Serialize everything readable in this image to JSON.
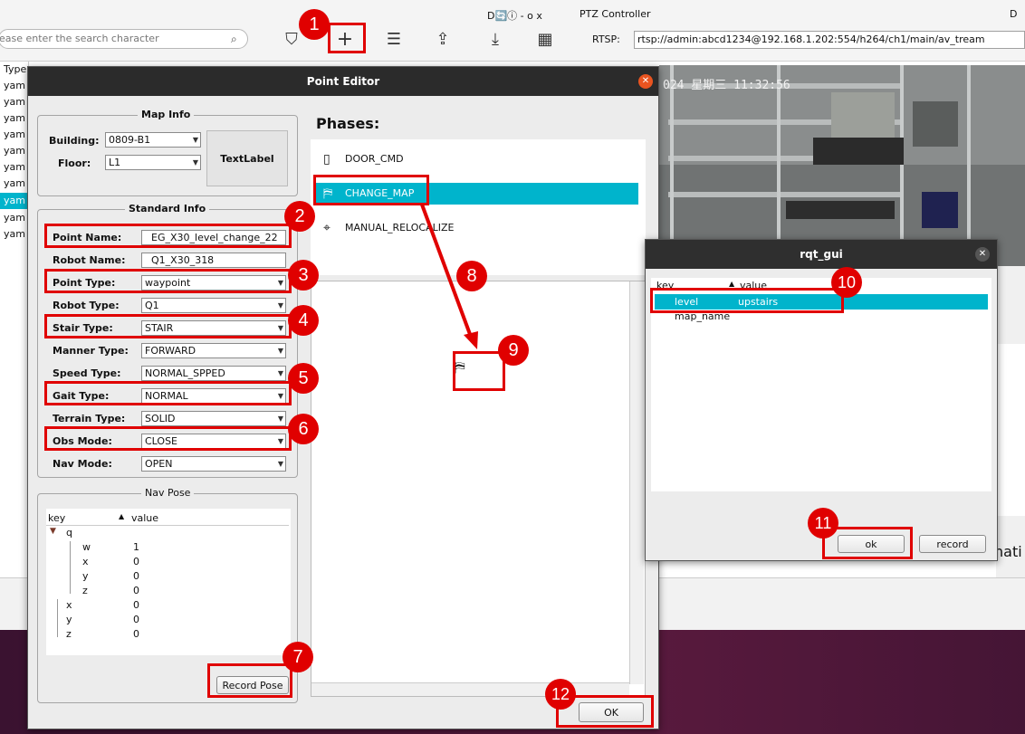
{
  "toolbar": {
    "search_placeholder": "ease enter the search character",
    "window_controls_1": "D🔄ⓘ  - o x",
    "ptz_title": "PTZ Controller",
    "window_controls_2": "D",
    "rtsp_label": "RTSP:",
    "rtsp_value": "rtsp://admin:abcd1234@192.168.1.202:554/h264/ch1/main/av_tream"
  },
  "background": {
    "list_header": "Type",
    "list_items": [
      "yam",
      "yam",
      "yam",
      "yam",
      "yam",
      "yam",
      "yam",
      "yam",
      "yam",
      "yam"
    ],
    "camera_timestamp": "024 星期三 11:32:56",
    "side_text": "nati"
  },
  "point_editor": {
    "title": "Point Editor",
    "map_info": {
      "title": "Map Info",
      "building_label": "Building:",
      "building_value": "0809-B1",
      "floor_label": "Floor:",
      "floor_value": "L1",
      "text_label": "TextLabel"
    },
    "standard_info": {
      "title": "Standard Info",
      "fields": [
        {
          "label": "Point Name:",
          "value": "EG_X30_level_change_22"
        },
        {
          "label": "Robot Name:",
          "value": "Q1_X30_318"
        },
        {
          "label": "Point Type:",
          "value": "waypoint"
        },
        {
          "label": "Robot Type:",
          "value": "Q1"
        },
        {
          "label": "Stair Type:",
          "value": "STAIR"
        },
        {
          "label": "Manner Type:",
          "value": "FORWARD"
        },
        {
          "label": "Speed Type:",
          "value": "NORMAL_SPPED"
        },
        {
          "label": "Gait Type:",
          "value": "NORMAL"
        },
        {
          "label": "Terrain Type:",
          "value": "SOLID"
        },
        {
          "label": "Obs Mode:",
          "value": "CLOSE"
        },
        {
          "label": "Nav Mode:",
          "value": "OPEN"
        }
      ]
    },
    "nav_pose": {
      "title": "Nav Pose",
      "col_key": "key",
      "col_value": "value",
      "rows": [
        {
          "key": "q",
          "value": ""
        },
        {
          "key": "w",
          "value": "1"
        },
        {
          "key": "x",
          "value": "0"
        },
        {
          "key": "y",
          "value": "0"
        },
        {
          "key": "z",
          "value": "0"
        },
        {
          "key": "x",
          "value": "0"
        },
        {
          "key": "y",
          "value": "0"
        },
        {
          "key": "z",
          "value": "0"
        }
      ]
    },
    "record_pose_label": "Record Pose",
    "phases_title": "Phases:",
    "phases": [
      "DOOR_CMD",
      "CHANGE_MAP",
      "MANUAL_RELOCALIZE"
    ],
    "ok_label": "OK"
  },
  "rqt_gui": {
    "title": "rqt_gui",
    "col_key": "key",
    "col_value": "value",
    "rows": [
      {
        "key": "level",
        "value": "upstairs"
      },
      {
        "key": "map_name",
        "value": ""
      }
    ],
    "ok_label": "ok",
    "record_label": "record"
  },
  "annotations": [
    "1",
    "2",
    "3",
    "4",
    "5",
    "6",
    "7",
    "8",
    "9",
    "10",
    "11",
    "12"
  ],
  "colors": {
    "annotation": "#e00000",
    "selection": "#00b4cc",
    "close_button": "#e95420"
  }
}
